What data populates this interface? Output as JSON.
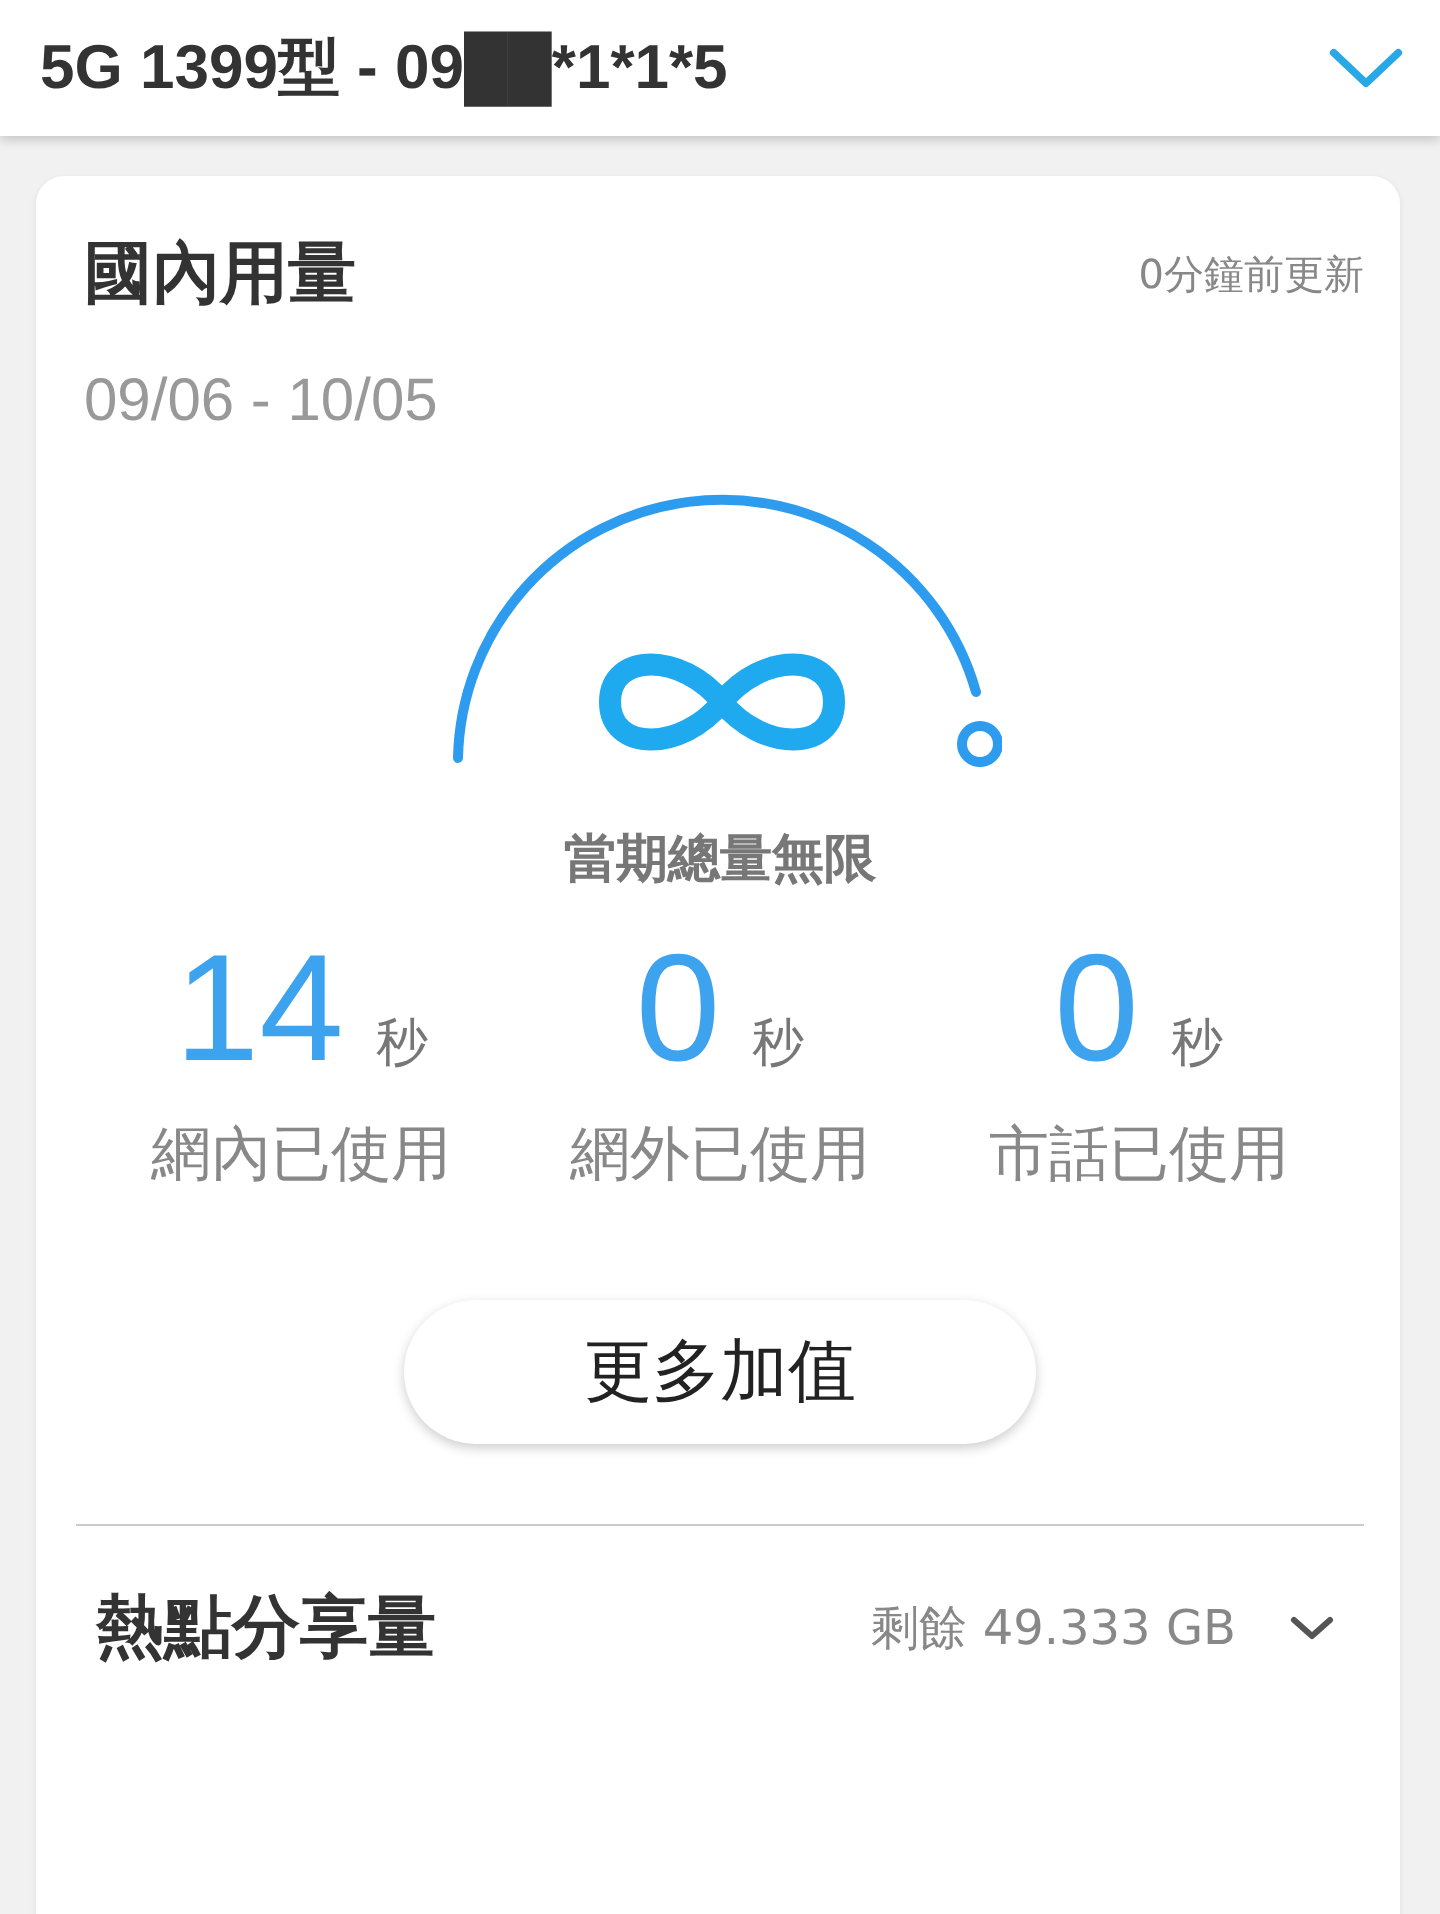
{
  "header": {
    "title": "5G 1399型 - 09██*1*1*5"
  },
  "usage_card": {
    "title": "國內用量",
    "updated": "0分鐘前更新",
    "period": "09/06 - 10/05",
    "gauge_label": "當期總量無限",
    "stats": [
      {
        "value": "14",
        "unit": "秒",
        "label": "網內已使用"
      },
      {
        "value": "0",
        "unit": "秒",
        "label": "網外已使用"
      },
      {
        "value": "0",
        "unit": "秒",
        "label": "市話已使用"
      }
    ],
    "button": "更多加值"
  },
  "hotspot": {
    "title": "熱點分享量",
    "remaining": "剩餘 49.333 GB",
    "expanded": false
  }
}
